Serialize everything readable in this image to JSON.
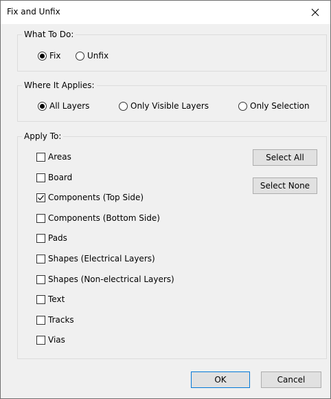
{
  "window": {
    "title": "Fix and Unfix"
  },
  "what_to_do": {
    "legend": "What To Do:",
    "options": [
      {
        "label": "Fix",
        "checked": true
      },
      {
        "label": "Unfix",
        "checked": false
      }
    ]
  },
  "where_applies": {
    "legend": "Where It Applies:",
    "options": [
      {
        "label": "All Layers",
        "checked": true
      },
      {
        "label": "Only Visible Layers",
        "checked": false
      },
      {
        "label": "Only Selection",
        "checked": false
      }
    ]
  },
  "apply_to": {
    "legend": "Apply To:",
    "items": [
      {
        "label": "Areas",
        "checked": false
      },
      {
        "label": "Board",
        "checked": false
      },
      {
        "label": "Components (Top Side)",
        "checked": true
      },
      {
        "label": "Components (Bottom Side)",
        "checked": false
      },
      {
        "label": "Pads",
        "checked": false
      },
      {
        "label": "Shapes (Electrical Layers)",
        "checked": false
      },
      {
        "label": "Shapes (Non-electrical Layers)",
        "checked": false
      },
      {
        "label": "Text",
        "checked": false
      },
      {
        "label": "Tracks",
        "checked": false
      },
      {
        "label": "Vias",
        "checked": false
      }
    ],
    "select_all_label": "Select All",
    "select_none_label": "Select None"
  },
  "footer": {
    "ok_label": "OK",
    "cancel_label": "Cancel"
  },
  "icons": {
    "close": "close-icon",
    "check": "check-icon"
  }
}
